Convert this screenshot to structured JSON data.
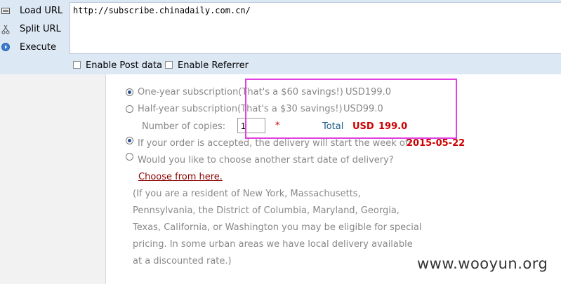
{
  "hackbar": {
    "load_url": "Load URL",
    "split_url": "Split URL",
    "execute": "Execute",
    "url_value": "http://subscribe.chinadaily.com.cn/",
    "enable_post": "Enable Post data",
    "enable_referrer": "Enable Referrer"
  },
  "form": {
    "one_year_label": "One-year subscription(That's a $60 savings!)",
    "one_year_price": "USD199.0",
    "half_year_label": "Half-year subscription(That's a $30 savings!)",
    "half_year_price": "USD99.0",
    "copies_label": "Number of copies:",
    "copies_value": "1",
    "required_mark": "*",
    "total_label": "Total",
    "total_currency": "USD",
    "total_value": "199.0",
    "delivery_text": "If your order is accepted, the delivery will start the week of:",
    "delivery_date": "2015-05-22",
    "choose_question": "Would you like to choose another start date of delivery?",
    "choose_link": "Choose from here.",
    "note_lines": [
      "(If you are a resident of New York, Massachusetts,",
      "Pennsylvania, the District of Columbia, Maryland, Georgia,",
      "Texas, California, or Washington you may be eligible for special",
      "pricing. In some urban areas we have local delivery available",
      "at a discounted rate.)"
    ]
  },
  "watermark": "www.wooyun.org",
  "colors": {
    "highlight": "#e040e0",
    "price_red": "#cc0000",
    "total_blue": "#1a5c8a",
    "link_red": "#8b0000"
  }
}
